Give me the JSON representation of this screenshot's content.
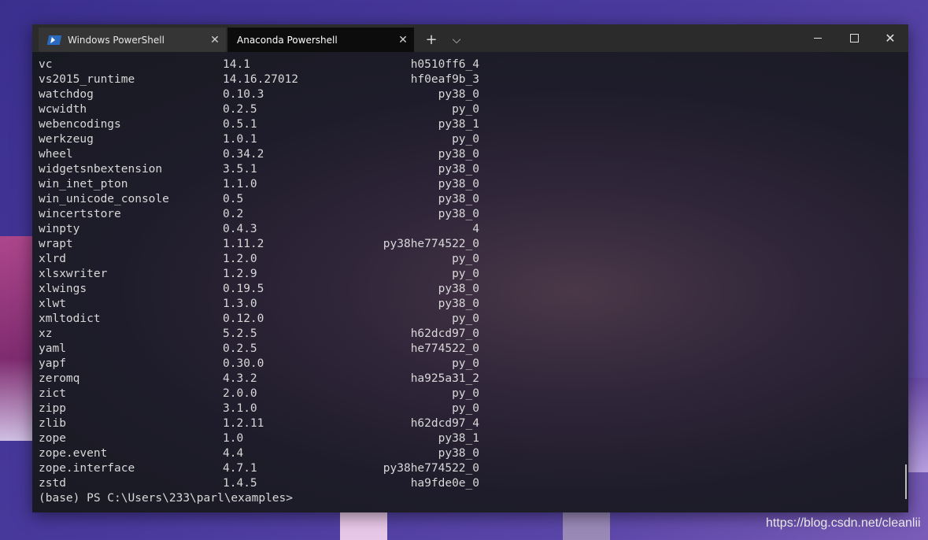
{
  "tabs": [
    {
      "label": "Windows PowerShell",
      "icon": "powershell-icon",
      "active": false
    },
    {
      "label": "Anaconda Powershell",
      "active": true
    }
  ],
  "tab_close_glyph": "✕",
  "new_tab_glyph": "+",
  "dropdown_glyph": "⌵",
  "packages": [
    [
      "vc",
      "14.1",
      "h0510ff6_4"
    ],
    [
      "vs2015_runtime",
      "14.16.27012",
      "hf0eaf9b_3"
    ],
    [
      "watchdog",
      "0.10.3",
      "py38_0"
    ],
    [
      "wcwidth",
      "0.2.5",
      "py_0"
    ],
    [
      "webencodings",
      "0.5.1",
      "py38_1"
    ],
    [
      "werkzeug",
      "1.0.1",
      "py_0"
    ],
    [
      "wheel",
      "0.34.2",
      "py38_0"
    ],
    [
      "widgetsnbextension",
      "3.5.1",
      "py38_0"
    ],
    [
      "win_inet_pton",
      "1.1.0",
      "py38_0"
    ],
    [
      "win_unicode_console",
      "0.5",
      "py38_0"
    ],
    [
      "wincertstore",
      "0.2",
      "py38_0"
    ],
    [
      "winpty",
      "0.4.3",
      "4"
    ],
    [
      "wrapt",
      "1.11.2",
      "py38he774522_0"
    ],
    [
      "xlrd",
      "1.2.0",
      "py_0"
    ],
    [
      "xlsxwriter",
      "1.2.9",
      "py_0"
    ],
    [
      "xlwings",
      "0.19.5",
      "py38_0"
    ],
    [
      "xlwt",
      "1.3.0",
      "py38_0"
    ],
    [
      "xmltodict",
      "0.12.0",
      "py_0"
    ],
    [
      "xz",
      "5.2.5",
      "h62dcd97_0"
    ],
    [
      "yaml",
      "0.2.5",
      "he774522_0"
    ],
    [
      "yapf",
      "0.30.0",
      "py_0"
    ],
    [
      "zeromq",
      "4.3.2",
      "ha925a31_2"
    ],
    [
      "zict",
      "2.0.0",
      "py_0"
    ],
    [
      "zipp",
      "3.1.0",
      "py_0"
    ],
    [
      "zlib",
      "1.2.11",
      "h62dcd97_4"
    ],
    [
      "zope",
      "1.0",
      "py38_1"
    ],
    [
      "zope.event",
      "4.4",
      "py38_0"
    ],
    [
      "zope.interface",
      "4.7.1",
      "py38he774522_0"
    ],
    [
      "zstd",
      "1.4.5",
      "ha9fde0e_0"
    ]
  ],
  "prompt": "(base) PS C:\\Users\\233\\parl\\examples>",
  "watermark": "https://blog.csdn.net/cleanlii",
  "colors": {
    "terminal_text": "#d8d8d8",
    "titlebar": "#2b2b2b",
    "active_tab": "#0c0c0c"
  }
}
